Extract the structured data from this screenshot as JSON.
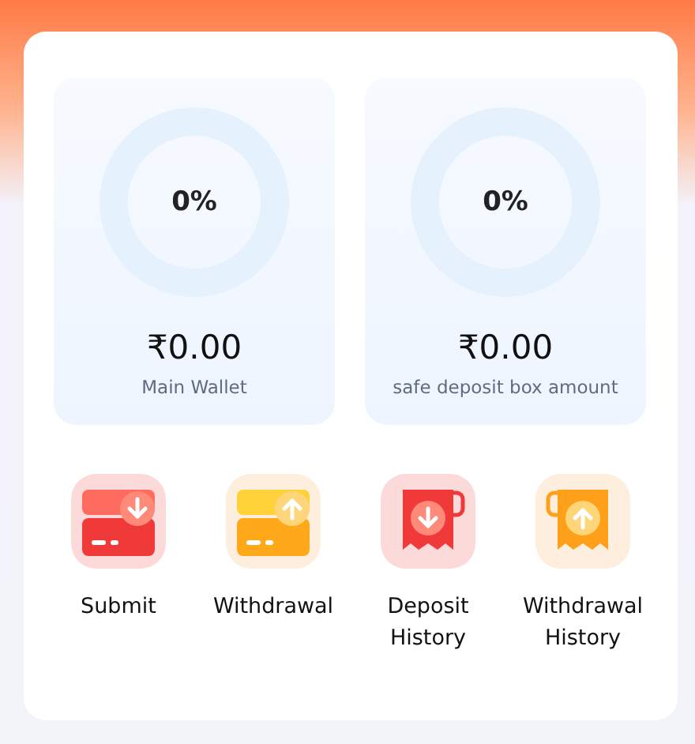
{
  "wallets": [
    {
      "percent": "0%",
      "amount": "₹0.00",
      "label": "Main Wallet"
    },
    {
      "percent": "0%",
      "amount": "₹0.00",
      "label": "safe deposit box amount"
    }
  ],
  "actions": [
    {
      "kind": "card-in",
      "label": "Submit"
    },
    {
      "kind": "card-out",
      "label": "Withdrawal"
    },
    {
      "kind": "receipt-in",
      "label": "Deposit History"
    },
    {
      "kind": "receipt-out",
      "label": "Withdrawal History"
    }
  ]
}
